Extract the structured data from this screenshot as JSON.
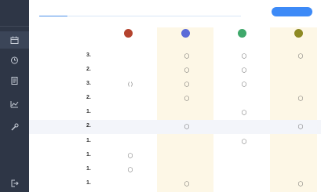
{
  "colors": {
    "sidebar": "#2e3646",
    "accent": "#3d8af7",
    "column_highlight": "#fdf7e6",
    "avatar_red": "#b4432e",
    "avatar_blue": "#5b6bd8",
    "avatar_green": "#3fa86b",
    "avatar_olive": "#8e8a24"
  },
  "sidebar": {
    "brand": "",
    "items": [
      {
        "icon": "calendar-icon",
        "label": ""
      },
      {
        "icon": "clock-icon",
        "label": ""
      },
      {
        "icon": "document-icon",
        "label": ""
      },
      {
        "icon": "chart-icon",
        "label": ""
      },
      {
        "icon": "wrench-icon",
        "label": ""
      },
      {
        "icon": "logout-icon",
        "label": ""
      }
    ]
  },
  "header": {
    "title": "",
    "action_button": ""
  },
  "columns": [
    {
      "avatar": "",
      "name": "",
      "icon": "user-red-avatar"
    },
    {
      "avatar": "",
      "name": "",
      "icon": "user-blue-avatar"
    },
    {
      "avatar": "",
      "name": "",
      "icon": "user-green-avatar"
    },
    {
      "avatar": "",
      "name": "",
      "icon": "user-olive-avatar"
    }
  ],
  "rows": [
    {
      "date": "",
      "time": "",
      "count": "3.",
      "badge": "",
      "marks": [
        "",
        "◯",
        "◯",
        "◯"
      ]
    },
    {
      "date": "",
      "time": "",
      "count": "2.",
      "badge": "",
      "marks": [
        "",
        "◯",
        "◯",
        ""
      ]
    },
    {
      "date": "",
      "time": "",
      "count": "3.",
      "badge": "",
      "marks": [
        "( )",
        "◯",
        "◯",
        ""
      ]
    },
    {
      "date": "",
      "time": "",
      "count": "2.",
      "badge": "",
      "marks": [
        "",
        "◯",
        "",
        "◯"
      ]
    },
    {
      "date": "",
      "time": "",
      "count": "1.",
      "badge": "",
      "marks": [
        "",
        "",
        "◯",
        ""
      ]
    },
    {
      "date": "",
      "time": "",
      "count": "2.",
      "badge": "",
      "marks": [
        "",
        "◯",
        "",
        "◯"
      ]
    },
    {
      "date": "",
      "time": "",
      "count": "1.",
      "badge": "",
      "marks": [
        "",
        "",
        "◯",
        ""
      ]
    },
    {
      "date": "",
      "time": "",
      "count": "1.",
      "badge": "",
      "marks": [
        "◯",
        "",
        "",
        ""
      ]
    },
    {
      "date": "",
      "time": "",
      "count": "1.",
      "badge": "",
      "marks": [
        "◯",
        "",
        "",
        ""
      ]
    },
    {
      "date": "",
      "time": "",
      "count": "1.",
      "badge": "",
      "marks": [
        "",
        "◯",
        "",
        "◯"
      ]
    }
  ]
}
